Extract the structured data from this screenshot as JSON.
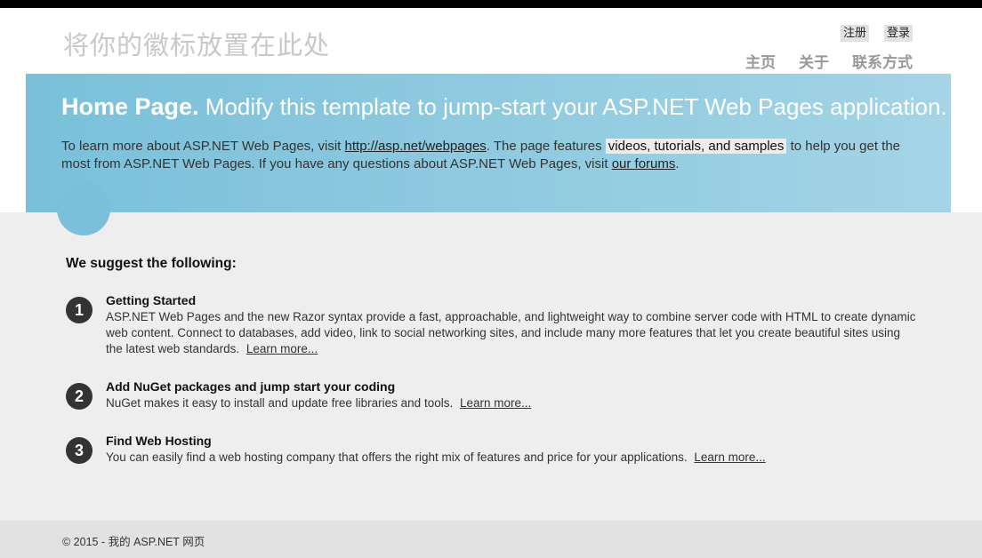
{
  "header": {
    "site_title": "将你的徽标放置在此处",
    "auth": {
      "register": "注册",
      "login": "登录"
    },
    "nav": {
      "home": "主页",
      "about": "关于",
      "contact": "联系方式"
    }
  },
  "featured": {
    "heading_bold": "Home Page.",
    "heading_rest": "Modify this template to jump-start your ASP.NET Web Pages application.",
    "text_1": "To learn more about ASP.NET Web Pages, visit",
    "link_webpages": "http://asp.net/webpages",
    "text_2": ". The page features",
    "mark_text": "videos, tutorials, and samples",
    "text_3": "to help you get the most from ASP.NET Web Pages. If you have any questions about ASP.NET Web Pages, visit",
    "link_forums": "our forums",
    "text_4": "."
  },
  "main": {
    "suggest_heading": "We suggest the following:",
    "steps": [
      {
        "number": "1",
        "title": "Getting Started",
        "text": "ASP.NET Web Pages and the new Razor syntax provide a fast, approachable, and lightweight way to combine server code with HTML to create dynamic web content. Connect to databases, add video, link to social networking sites, and include many more features that let you create beautiful sites using the latest web standards.",
        "link": "Learn more..."
      },
      {
        "number": "2",
        "title": "Add NuGet packages and jump start your coding",
        "text": "NuGet makes it easy to install and update free libraries and tools.",
        "link": "Learn more..."
      },
      {
        "number": "3",
        "title": "Find Web Hosting",
        "text": "You can easily find a web hosting company that offers the right mix of features and price for your applications.",
        "link": "Learn more..."
      }
    ]
  },
  "footer": {
    "copyright": "© 2015 - 我的 ASP.NET 网页"
  },
  "colors": {
    "featured_start": "#7ac0da",
    "featured_end": "#a4d4e6",
    "main_bg": "#efeeef",
    "footer_bg": "#e2e2e2"
  }
}
